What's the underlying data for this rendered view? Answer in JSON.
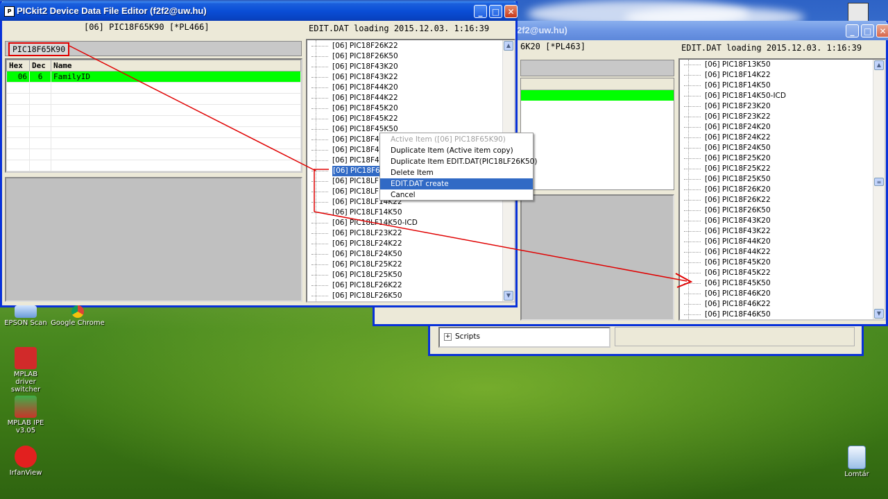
{
  "colors": {
    "title_bar": "#0a4ed6",
    "selection": "#316ac5",
    "family_row": "#00ff00",
    "annotation_red": "#e00000"
  },
  "main_window": {
    "title": "PICkit2 Device Data File Editor (f2f2@uw.hu)",
    "header_left": "[06] PIC18F65K90 [*PL466]",
    "header_right": "EDIT.DAT loading 2015.12.03. 1:16:39",
    "device_name": "PIC18F65K90",
    "table": {
      "headers": [
        "Hex",
        "Dec",
        "Name"
      ],
      "rows": [
        {
          "hex": "06",
          "dec": "6",
          "name": "FamilyID"
        }
      ]
    },
    "tree_items": [
      "[06] PIC18F26K22",
      "[06] PIC18F26K50",
      "[06] PIC18F43K20",
      "[06] PIC18F43K22",
      "[06] PIC18F44K20",
      "[06] PIC18F44K22",
      "[06] PIC18F45K20",
      "[06] PIC18F45K22",
      "[06] PIC18F45K50",
      "[06] PIC18F46K",
      "[06] PIC18F46K",
      "[06] PIC18F46K",
      "[06] PIC18F65K",
      "[06] PIC18LF13",
      "[06] PIC18LF13",
      "[06] PIC18LF14K22",
      "[06] PIC18LF14K50",
      "[06] PIC18LF14K50-ICD",
      "[06] PIC18LF23K22",
      "[06] PIC18LF24K22",
      "[06] PIC18LF24K50",
      "[06] PIC18LF25K22",
      "[06] PIC18LF25K50",
      "[06] PIC18LF26K22",
      "[06] PIC18LF26K50"
    ],
    "selected_index": 12
  },
  "context_menu": {
    "items": [
      "Active Item ([06] PIC18F65K90)",
      "Duplicate Item (Active item copy)",
      "Duplicate Item EDIT.DAT(PIC18LF26K50)",
      "Delete Item",
      "EDIT.DAT create",
      "Cancel"
    ],
    "disabled_index": 0,
    "highlighted_index": 4
  },
  "back_window": {
    "title_fragment": "2f2@uw.hu)",
    "header_left_fragment": "6K20 [*PL463]",
    "header_right": "EDIT.DAT loading 2015.12.03. 1:16:39",
    "tree_items": [
      "[06] PIC18F13K50",
      "[06] PIC18F14K22",
      "[06] PIC18F14K50",
      "[06] PIC18F14K50-ICD",
      "[06] PIC18F23K20",
      "[06] PIC18F23K22",
      "[06] PIC18F24K20",
      "[06] PIC18F24K22",
      "[06] PIC18F24K50",
      "[06] PIC18F25K20",
      "[06] PIC18F25K22",
      "[06] PIC18F25K50",
      "[06] PIC18F26K20",
      "[06] PIC18F26K22",
      "[06] PIC18F26K50",
      "[06] PIC18F43K20",
      "[06] PIC18F43K22",
      "[06] PIC18F44K20",
      "[06] PIC18F44K22",
      "[06] PIC18F45K20",
      "[06] PIC18F45K22",
      "[06] PIC18F45K50",
      "[06] PIC18F46K20",
      "[06] PIC18F46K22",
      "[06] PIC18F46K50"
    ]
  },
  "third_window": {
    "tree_label": "Scripts"
  },
  "desktop_icons": [
    {
      "label": "EPSON Scan",
      "icon": "epson-scan-icon"
    },
    {
      "label": "Google Chrome",
      "icon": "chrome-icon"
    },
    {
      "label": "MPLAB driver switcher",
      "icon": "mplab-driver-switcher-icon"
    },
    {
      "label": "MPLAB IPE v3.05",
      "icon": "mplab-ipe-icon"
    },
    {
      "label": "IrfanView",
      "icon": "irfanview-icon"
    },
    {
      "label": "Lomtár",
      "icon": "recycle-bin-icon"
    }
  ],
  "title_buttons": [
    "_",
    "□",
    "✕"
  ]
}
